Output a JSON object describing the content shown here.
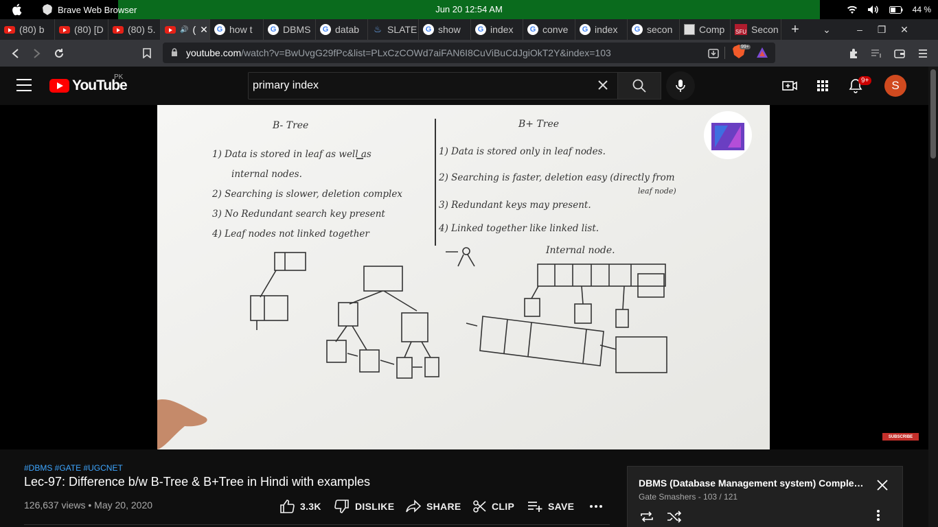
{
  "os": {
    "app_name": "Brave Web Browser",
    "datetime": "Jun 20  12:54 AM",
    "battery": "44 %"
  },
  "tabs": [
    {
      "label": "(80) b",
      "icon": "youtube-icon"
    },
    {
      "label": "(80) [D",
      "icon": "youtube-icon"
    },
    {
      "label": "(80) 5.",
      "icon": "youtube-icon"
    },
    {
      "label": "(",
      "icon": "youtube-icon",
      "active": true
    },
    {
      "label": "how t",
      "icon": "google-icon"
    },
    {
      "label": "DBMS",
      "icon": "google-icon"
    },
    {
      "label": "datab",
      "icon": "google-icon"
    },
    {
      "label": "SLATE",
      "icon": "slate-icon"
    },
    {
      "label": "show",
      "icon": "google-icon"
    },
    {
      "label": "index",
      "icon": "google-icon"
    },
    {
      "label": "conve",
      "icon": "google-icon"
    },
    {
      "label": "index",
      "icon": "google-icon"
    },
    {
      "label": "secon",
      "icon": "google-icon"
    },
    {
      "label": "Comp",
      "icon": "page-icon"
    },
    {
      "label": "Secon",
      "icon": "sfu-icon"
    }
  ],
  "browser": {
    "url_host": "youtube.com",
    "url_path": "/watch?v=BwUvgG29fPc&list=PLxCzCOWd7aiFAN6I8CuViBuCdJgiOkT2Y&index=103",
    "brave_badge": "99+"
  },
  "youtube": {
    "logo_text": "YouTube",
    "region": "PK",
    "search_value": "primary index",
    "notification_count": "9+",
    "avatar_letter": "S"
  },
  "video": {
    "subscribe_label": "SUBSCRIBE",
    "tags": "#DBMS #GATE #UGCNET",
    "title": "Lec-97: Difference b/w B-Tree & B+Tree in Hindi with examples",
    "views_date": "126,637 views • May 20, 2020",
    "actions": {
      "likes": "3.3K",
      "dislike": "DISLIKE",
      "share": "SHARE",
      "clip": "CLIP",
      "save": "SAVE"
    }
  },
  "whiteboard": {
    "left_heading": "B- Tree",
    "right_heading": "B+ Tree",
    "left_points": [
      "1) Data is stored in leaf as well as",
      "internal nodes.",
      "2) Searching is slower, deletion complex",
      "3) No Redundant search key present",
      "4) Leaf nodes not linked together"
    ],
    "right_points": [
      "1) Data is stored only in leaf nodes.",
      "2) Searching is faster, deletion easy (directly from",
      "leaf node)",
      "3) Redundant keys may present.",
      "4) Linked together like linked list."
    ],
    "internal_label": "Internal node."
  },
  "playlist": {
    "title": "DBMS (Database Management system) Complete ...",
    "channel_progress": "Gate Smashers - 103 / 121"
  }
}
